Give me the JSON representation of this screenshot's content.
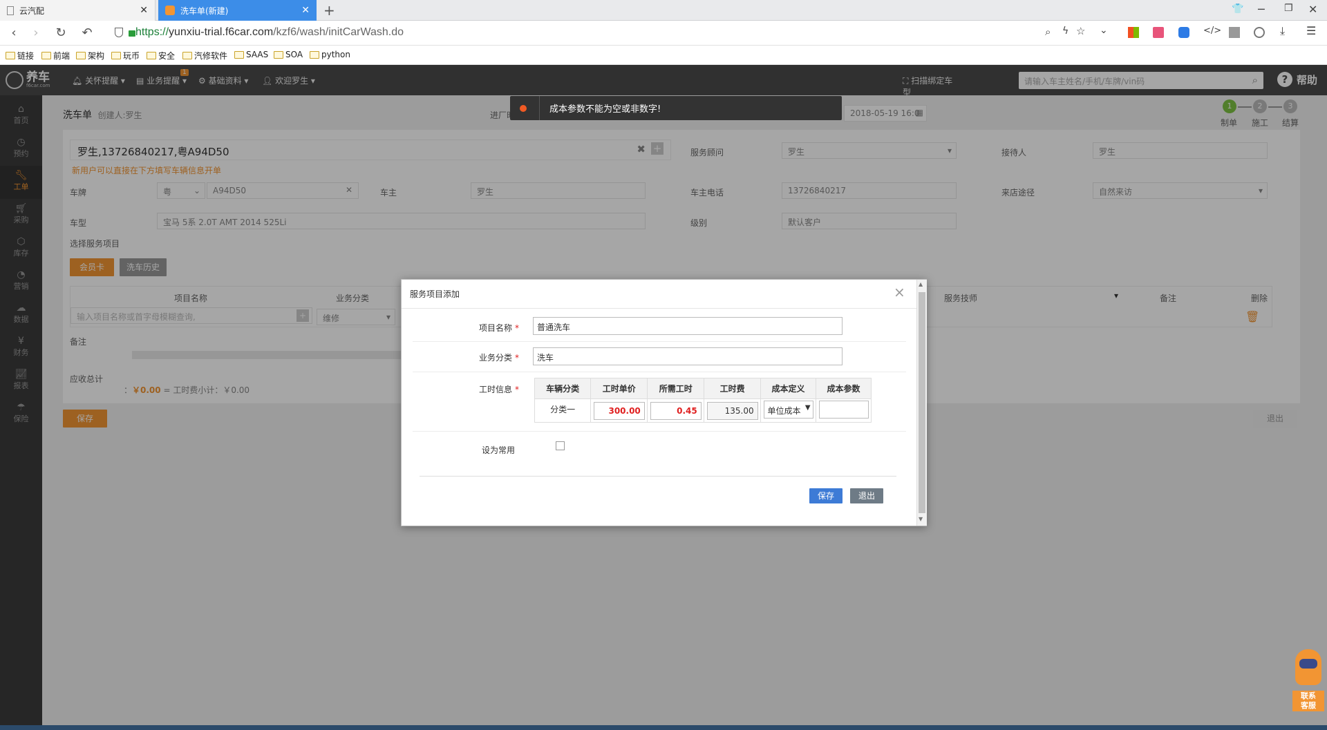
{
  "browser": {
    "tabs": [
      {
        "label": "云汽配"
      },
      {
        "label": "洗车单(新建)"
      }
    ],
    "url_scheme": "https://",
    "url_host": "yunxiu-trial.f6car.com",
    "url_path": "/kzf6/wash/initCarWash.do",
    "bookmarks": [
      "链接",
      "前端",
      "架构",
      "玩币",
      "安全",
      "汽修软件",
      "SAAS",
      "SOA",
      "python"
    ]
  },
  "app": {
    "logo": "养车",
    "logo_sub": "f6car.com",
    "nav": [
      {
        "label": "关怀提醒",
        "icon": "bell-icon"
      },
      {
        "label": "业务提醒",
        "icon": "clipboard-icon",
        "badge": "1"
      },
      {
        "label": "基础资料",
        "icon": "gear-icon"
      },
      {
        "label": "欢迎罗生",
        "icon": "user-icon"
      }
    ],
    "scan_label": "扫描绑定车型",
    "search_placeholder": "请输入车主姓名/手机/车牌/vin码",
    "help_label": "帮助",
    "sidebar": [
      {
        "label": "首页",
        "icon": "home-icon"
      },
      {
        "label": "预约",
        "icon": "clock-icon"
      },
      {
        "label": "工单",
        "icon": "wrench-icon",
        "active": true
      },
      {
        "label": "采购",
        "icon": "cart-icon"
      },
      {
        "label": "库存",
        "icon": "box-icon"
      },
      {
        "label": "营销",
        "icon": "target-icon"
      },
      {
        "label": "数据",
        "icon": "cloud-icon"
      },
      {
        "label": "财务",
        "icon": "yen-icon"
      },
      {
        "label": "报表",
        "icon": "chart-icon"
      },
      {
        "label": "保险",
        "icon": "umbrella-icon"
      }
    ]
  },
  "page": {
    "title": "洗车单",
    "creator": "创建人:罗生",
    "entry_label": "进厂时",
    "entry_date": "2018-05-19 16:0",
    "steps": [
      {
        "num": "1",
        "label": "制单"
      },
      {
        "num": "2",
        "label": "施工"
      },
      {
        "num": "3",
        "label": "结算"
      }
    ],
    "customer": "罗生,13726840217,粤A94D50",
    "customer_hint": "新用户可以直接在下方填写车辆信息开单",
    "service_advisor_label": "服务顾问",
    "service_advisor": "罗生",
    "receiver_label": "接待人",
    "receiver": "罗生",
    "plate_label": "车牌",
    "plate_prefix": "粤",
    "plate_number": "A94D50",
    "owner_label": "车主",
    "owner": "罗生",
    "owner_phone_label": "车主电话",
    "owner_phone": "13726840217",
    "source_label": "来店途径",
    "source": "自然来访",
    "model_label": "车型",
    "model": "宝马 5系 2.0T AMT 2014 525Li",
    "level_label": "级别",
    "level": "默认客户",
    "select_service_label": "选择服务项目",
    "btn_member_card": "会员卡",
    "btn_wash_history": "洗车历史",
    "table_headers": [
      "项目名称",
      "业务分类",
      "服务技师",
      "备注",
      "删除"
    ],
    "item_placeholder": "输入项目名称或首字母模糊查询,",
    "category_default": "维修",
    "remark_label": "备注",
    "total_label": "应收总计",
    "total_value": "￥0.00",
    "total_formula": "= 工时费小计：￥0.00",
    "save_label": "保存",
    "exit_label": "退出"
  },
  "toast": {
    "message": "成本参数不能为空或非数字!"
  },
  "modal": {
    "title": "服务项目添加",
    "name_label": "项目名称",
    "name_value": "普通洗车",
    "category_label": "业务分类",
    "category_value": "洗车",
    "labor_label": "工时信息",
    "labor_headers": [
      "车辆分类",
      "工时单价",
      "所需工时",
      "工时费",
      "成本定义",
      "成本参数"
    ],
    "labor_row": {
      "vehicle_class": "分类一",
      "unit_price": "300.00",
      "hours": "0.45",
      "fee": "135.00",
      "cost_def": "单位成本",
      "cost_param": ""
    },
    "common_label": "设为常用",
    "save_label": "保存",
    "exit_label": "退出"
  },
  "support": {
    "label": "联系客服"
  }
}
